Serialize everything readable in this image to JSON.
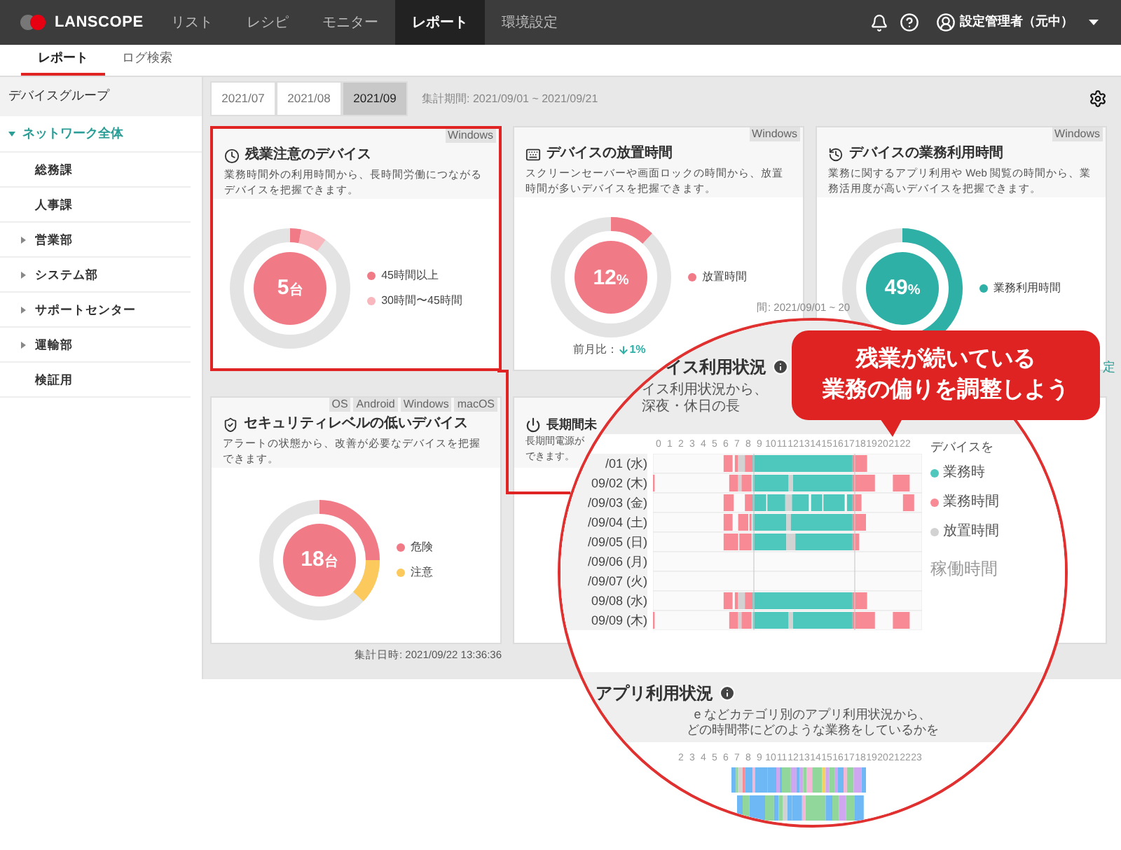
{
  "header": {
    "logo": "LANSCOPE",
    "nav": [
      {
        "label": "リスト",
        "selected": false
      },
      {
        "label": "レシピ",
        "selected": false
      },
      {
        "label": "モニター",
        "selected": false
      },
      {
        "label": "レポート",
        "selected": true
      },
      {
        "label": "環境設定",
        "selected": false
      }
    ],
    "user": "設定管理者（元中）"
  },
  "subtabs": [
    {
      "label": "レポート",
      "selected": true
    },
    {
      "label": "ログ検索",
      "selected": false
    }
  ],
  "sidebar": {
    "title": "デバイスグループ",
    "root": {
      "label": "ネットワーク全体",
      "expanded": true,
      "children": [
        {
          "label": "総務課",
          "kind": "leaf"
        },
        {
          "label": "人事課",
          "kind": "leaf"
        },
        {
          "label": "営業部",
          "kind": "group"
        },
        {
          "label": "システム部",
          "kind": "group"
        },
        {
          "label": "サポートセンター",
          "kind": "group"
        },
        {
          "label": "運輸部",
          "kind": "group"
        },
        {
          "label": "検証用",
          "kind": "leaf"
        }
      ]
    }
  },
  "period_tabs": [
    {
      "label": "2021/07",
      "selected": false
    },
    {
      "label": "2021/08",
      "selected": false
    },
    {
      "label": "2021/09",
      "selected": true
    }
  ],
  "period_text": "集計期間: 2021/09/01 ~ 2021/09/21",
  "period_fragment": "間: 2021/09/01 ~ 20",
  "settings_link_fragment": "定",
  "cards": [
    {
      "kind": "donut",
      "highlighted": true,
      "os_tags": [
        "Windows"
      ],
      "title": "残業注意のデバイス",
      "description": "業務時間外の利用時間から、長時間労働につながるデバイスを把握できます。",
      "center_value": "5",
      "center_unit": "台",
      "segments": [
        {
          "label": "45時間以上",
          "color": "#f17a87"
        },
        {
          "label": "30時間〜45時間",
          "color": "#f8b6bd"
        }
      ]
    },
    {
      "kind": "donut",
      "highlighted": false,
      "os_tags": [
        "Windows"
      ],
      "title": "デバイスの放置時間",
      "description": "スクリーンセーバーや画面ロックの時間から、放置時間が多いデバイスを把握できます。",
      "center_value": "12",
      "center_unit": "%",
      "segments": [
        {
          "label": "放置時間",
          "color": "#f17a87"
        }
      ],
      "comparison": {
        "label": "前月比：",
        "value": "1%"
      }
    },
    {
      "kind": "donut",
      "highlighted": false,
      "os_tags": [
        "Windows"
      ],
      "title": "デバイスの業務利用時間",
      "description": "業務に関するアプリ利用や Web 閲覧の時間から、業務活用度が高いデバイスを把握できます。",
      "center_value": "49",
      "center_unit": "%",
      "segments": [
        {
          "label": "業務利用時間",
          "color": "#2fb0a7"
        }
      ]
    },
    {
      "kind": "donut",
      "highlighted": false,
      "os_tags": [
        "OS",
        "Android",
        "Windows",
        "macOS"
      ],
      "title": "セキュリティレベルの低いデバイス",
      "description": "アラートの状態から、改善が必要なデバイスを把握できます。",
      "center_value": "18",
      "center_unit": "台",
      "segments": [
        {
          "label": "危険",
          "color": "#f17a87"
        },
        {
          "label": "注意",
          "color": "#fcc95c"
        }
      ]
    },
    {
      "kind": "text",
      "highlighted": false,
      "title": "長期間未",
      "description_lines": [
        "長期間電源が",
        "できます。"
      ]
    },
    {
      "kind": "blank",
      "highlighted": false
    }
  ],
  "collected_at": "集計日時: 2021/09/22 13:36:36",
  "magnifier": {
    "usage": {
      "title": "イス利用状況",
      "description_lines": [
        "イス利用状況から、",
        "深夜・休日の長"
      ],
      "hours": [
        "0",
        "1",
        "2",
        "3",
        "4",
        "5",
        "6",
        "7",
        "8",
        "9",
        "10",
        "11",
        "12",
        "13",
        "14",
        "15",
        "16",
        "17",
        "18",
        "19",
        "20",
        "21",
        "22"
      ],
      "rows": [
        {
          "date": "/01 (水)"
        },
        {
          "date": "09/02 (木)"
        },
        {
          "date": "/09/03 (金)"
        },
        {
          "date": "/09/04 (土)"
        },
        {
          "date": "/09/05 (日)"
        },
        {
          "date": "/09/06 (月)"
        },
        {
          "date": "/09/07 (火)"
        },
        {
          "date": "09/08 (水)"
        },
        {
          "date": "09/09 (木)"
        }
      ],
      "legend_intro": "デバイスを",
      "legend": [
        {
          "label": "業務時",
          "color": "#4ec7bd"
        },
        {
          "label": "業務時間",
          "color": "#f88a96"
        },
        {
          "label": "放置時間",
          "color": "#d2d2d2"
        }
      ],
      "total_label": "稼働時間"
    },
    "apps": {
      "title": "アプリ利用状況",
      "description_lines": [
        "e などカテゴリ別のアプリ利用状況から、",
        "どの時間帯にどのような業務をしているかを"
      ],
      "hours": [
        "2",
        "3",
        "4",
        "5",
        "6",
        "7",
        "8",
        "9",
        "10",
        "11",
        "12",
        "13",
        "14",
        "15",
        "16",
        "17",
        "18",
        "19",
        "20",
        "21",
        "22",
        "23"
      ]
    }
  },
  "callout": {
    "lines": [
      "残業が続いている",
      "業務の偏りを調整しよう"
    ]
  }
}
